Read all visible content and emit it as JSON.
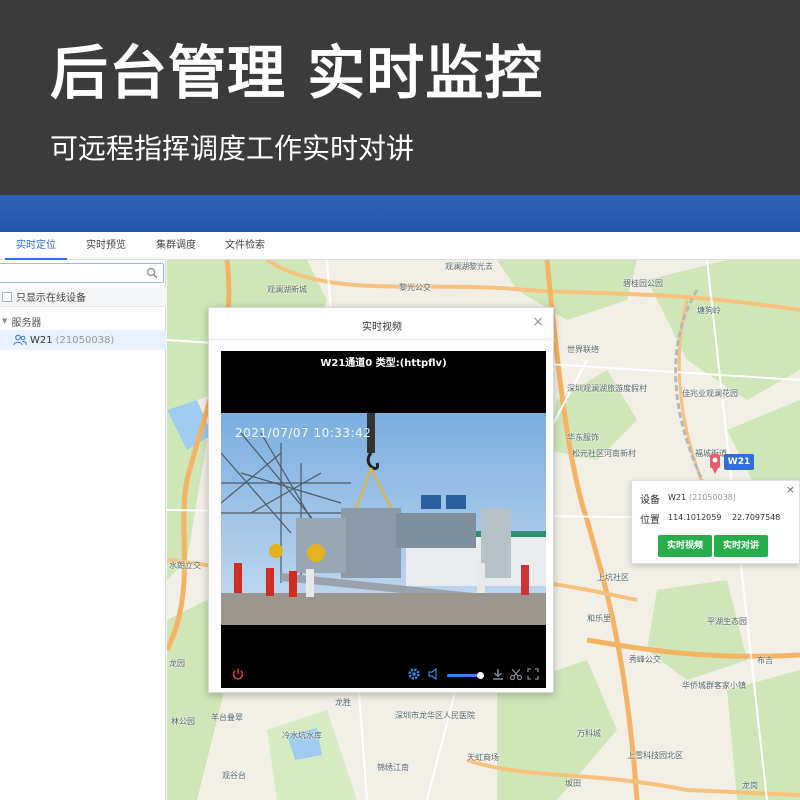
{
  "banner": {
    "title": "后台管理 实时监控",
    "subtitle": "可远程指挥调度工作实时对讲"
  },
  "tabs": [
    {
      "label": "实时定位",
      "active": true
    },
    {
      "label": "实时预览",
      "active": false
    },
    {
      "label": "集群调度",
      "active": false
    },
    {
      "label": "文件检索",
      "active": false
    }
  ],
  "sidebar": {
    "search": {
      "value": "",
      "placeholder": ""
    },
    "online_only_label": "只显示在线设备",
    "server_label": "服务器",
    "device": {
      "name": "W21",
      "id": "(21050038)"
    }
  },
  "map": {
    "labels": [
      "观澜湖黎光去",
      "黎光公交",
      "观澜湖新城",
      "碧桂园公园",
      "塘狗岭",
      "世界联络",
      "深圳观澜湖旅游度假村",
      "华东服饰",
      "佳兆业观澜花园",
      "松元社区河南新村",
      "福城街道",
      "上坑社区",
      "和乐里",
      "平湖生态园",
      "秀峰公交",
      "华侨城群客家小镇",
      "布吉",
      "水朗立交",
      "龙园",
      "林公园",
      "羊台叠翠",
      "观谷台",
      "龙胜",
      "冷水坑水库",
      "深圳市龙华区人民医院",
      "锦绣江南",
      "天虹商场",
      "万科城",
      "上雪科技园北区",
      "坂田",
      "龙岗"
    ]
  },
  "video_dialog": {
    "title": "实时视频",
    "close": "×",
    "header": "W21通道0  类型:(httpflv)",
    "timestamp": "2021/07/07 10:33:42",
    "volume": 0.9
  },
  "info_popup": {
    "marker_label": "W21",
    "close": "×",
    "device_key": "设备",
    "device_name": "W21",
    "device_id": "(21050038)",
    "position_key": "位置",
    "longitude": "114.1012059",
    "latitude": "22.7097548",
    "btn_video": "实时视频",
    "btn_intercom": "实时对讲"
  },
  "colors": {
    "banner_bg": "#3b3b3c",
    "blue_bar": "#2455a8",
    "accent": "#2f6fd6",
    "button_green": "#27ae4a"
  }
}
